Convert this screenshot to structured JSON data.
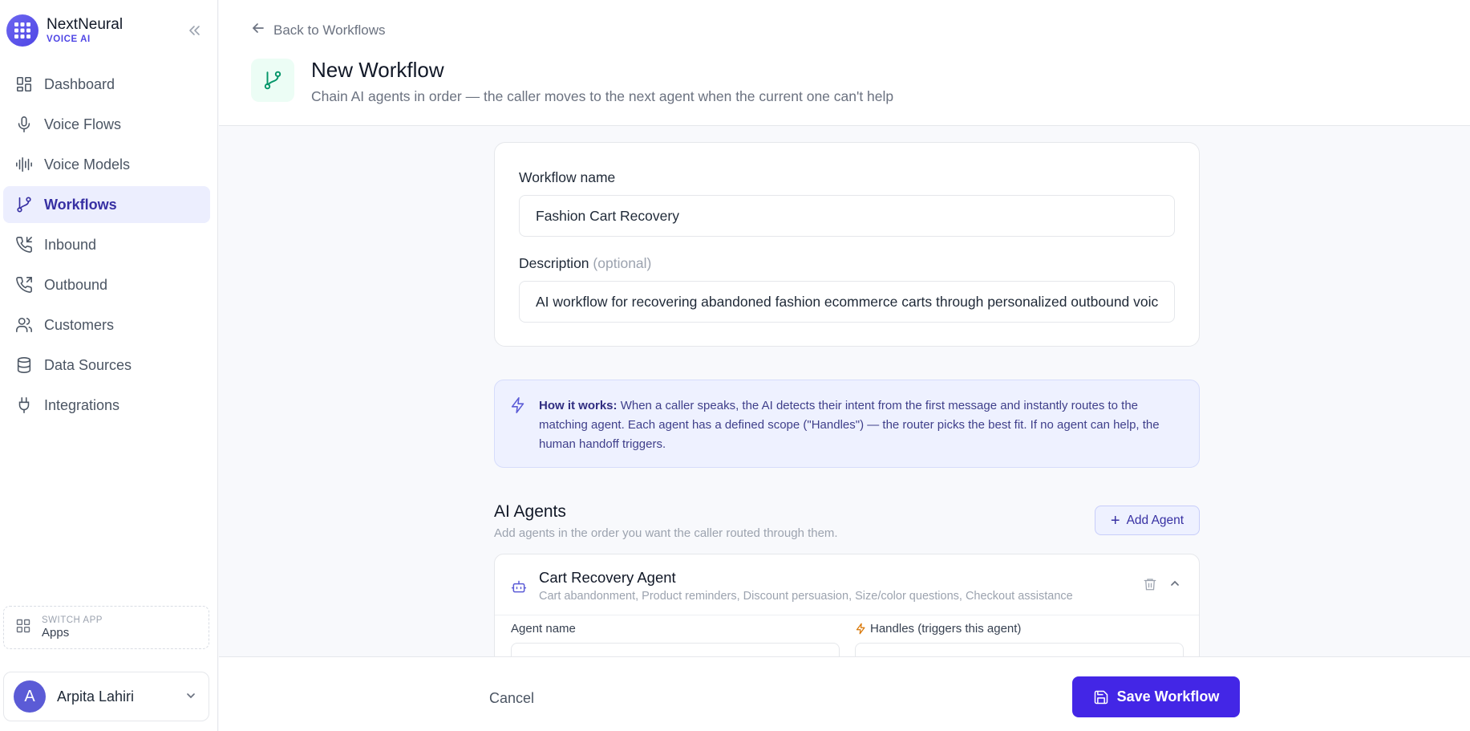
{
  "brand": {
    "name": "NextNeural",
    "subtitle": "VOICE AI"
  },
  "sidebar": {
    "items": [
      {
        "label": "Dashboard",
        "icon": "dashboard-icon",
        "active": false
      },
      {
        "label": "Voice Flows",
        "icon": "microphone-icon",
        "active": false
      },
      {
        "label": "Voice Models",
        "icon": "audio-waveform-icon",
        "active": false
      },
      {
        "label": "Workflows",
        "icon": "git-branch-icon",
        "active": true
      },
      {
        "label": "Inbound",
        "icon": "phone-incoming-icon",
        "active": false
      },
      {
        "label": "Outbound",
        "icon": "phone-outgoing-icon",
        "active": false
      },
      {
        "label": "Customers",
        "icon": "users-icon",
        "active": false
      },
      {
        "label": "Data Sources",
        "icon": "database-icon",
        "active": false
      },
      {
        "label": "Integrations",
        "icon": "plug-icon",
        "active": false
      }
    ],
    "switch_app": {
      "caption": "SWITCH APP",
      "label": "Apps"
    },
    "user": {
      "initial": "A",
      "name": "Arpita Lahiri"
    }
  },
  "header": {
    "back_label": "Back to Workflows",
    "title": "New Workflow",
    "subtitle": "Chain AI agents in order — the caller moves to the next agent when the current one can't help"
  },
  "form": {
    "name_label": "Workflow name",
    "name_value": "Fashion Cart Recovery",
    "description_label": "Description",
    "description_optional": "(optional)",
    "description_value": "AI workflow for recovering abandoned fashion ecommerce carts through personalized outbound voice calls"
  },
  "info": {
    "heading": "How it works:",
    "text": "When a caller speaks, the AI detects their intent from the first message and instantly routes to the matching agent. Each agent has a defined scope (\"Handles\") — the router picks the best fit. If no agent can help, the human handoff triggers."
  },
  "agents_section": {
    "title": "AI Agents",
    "subtitle": "Add agents in the order you want the caller routed through them.",
    "add_label": "Add Agent"
  },
  "agent": {
    "name": "Cart Recovery Agent",
    "tags": "Cart abandonment, Product reminders, Discount persuasion, Size/color questions, Checkout assistance",
    "name_field_label": "Agent name",
    "handles_field_label": "Handles (triggers this agent)"
  },
  "footer": {
    "cancel_label": "Cancel",
    "save_label": "Save Workflow"
  },
  "colors": {
    "accent": "#4326e6",
    "active_bg": "#eceefe",
    "info_bg": "#eef1ff"
  }
}
